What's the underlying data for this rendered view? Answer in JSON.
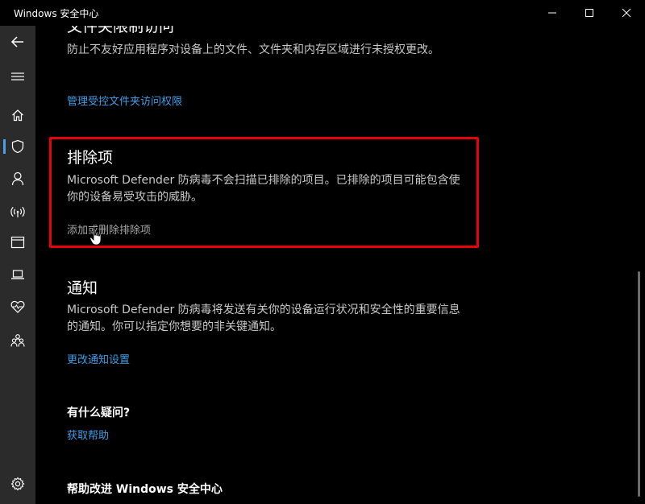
{
  "window": {
    "title": "Windows 安全中心"
  },
  "sidebar": {
    "items": [
      {
        "icon": "back-icon"
      },
      {
        "icon": "hamburger-menu-icon"
      },
      {
        "icon": "home-icon"
      },
      {
        "icon": "shield-icon",
        "active": true
      },
      {
        "icon": "person-icon"
      },
      {
        "icon": "wireless-icon"
      },
      {
        "icon": "app-browser-icon"
      },
      {
        "icon": "laptop-icon"
      },
      {
        "icon": "health-heart-icon"
      },
      {
        "icon": "family-icon"
      },
      {
        "icon": "gear-icon"
      }
    ],
    "accent_color": "#4a9fe8"
  },
  "sections": {
    "controlled_folder": {
      "title": "文件夹限制访问",
      "description": "防止不友好应用程序对设备上的文件、文件夹和内存区域进行未授权更改。",
      "link": "管理受控文件夹访问权限"
    },
    "exclusions": {
      "title": "排除项",
      "description": "Microsoft Defender 防病毒不会扫描已排除的项目。已排除的项目可能包含使你的设备易受攻击的威胁。",
      "link": "添加或删除排除项"
    },
    "notifications": {
      "title": "通知",
      "description": "Microsoft Defender 防病毒将发送有关你的设备运行状况和安全性的重要信息的通知。你可以指定你想要的非关键通知。",
      "link": "更改通知设置"
    },
    "questions": {
      "title": "有什么疑问?",
      "link": "获取帮助"
    },
    "improve": {
      "title": "帮助改进 Windows 安全中心"
    }
  },
  "colors": {
    "link": "#3f9ee8",
    "highlight_box": "#e8000c",
    "background": "#000000",
    "sidebar": "#2b2b2b"
  }
}
